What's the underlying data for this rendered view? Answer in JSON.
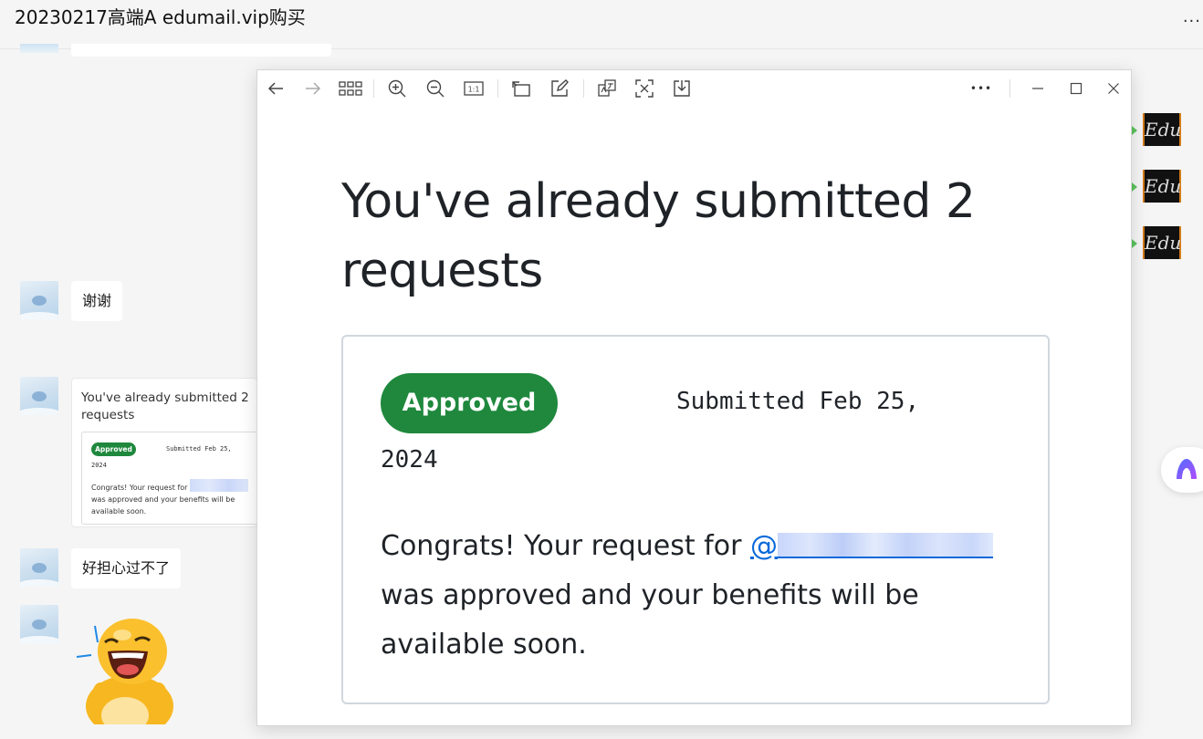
{
  "chat": {
    "title": "20230217高端A edumail.vip购买",
    "more": "...",
    "messages": [
      {
        "text": "谢谢"
      },
      {
        "text": "好担心过不了"
      }
    ],
    "thumbnail": {
      "title": "You've already submitted 2 requests",
      "badge": "Approved",
      "submitted": "Submitted Feb 25,",
      "year": "2024",
      "body_pre": "Congrats! Your request for",
      "body_post": "was approved and your benefits will be available soon."
    },
    "side_images": [
      {
        "label": "Edu"
      },
      {
        "label": "Edu"
      },
      {
        "label": "Edu"
      }
    ]
  },
  "viewer": {
    "toolbar": {
      "back_icon": "arrow-left-icon",
      "forward_icon": "arrow-right-icon",
      "gallery_icon": "grid-icon",
      "zoom_in_icon": "zoom-in-icon",
      "zoom_out_icon": "zoom-out-icon",
      "actual_size_label": "1:1",
      "rotate_icon": "rotate-icon",
      "edit_icon": "edit-icon",
      "translate_icon": "translate-icon",
      "extract_text_icon": "extract-text-icon",
      "download_icon": "download-icon",
      "more_label": "•••",
      "minimize_icon": "minimize-icon",
      "maximize_icon": "maximize-icon",
      "close_icon": "close-icon"
    },
    "image": {
      "title": "You've already submitted 2 requests",
      "badge": "Approved",
      "submitted": "Submitted Feb 25,",
      "year": "2024",
      "at_sign": "@",
      "body_pre": "Congrats! Your request for",
      "body_post": "was approved and your benefits will be available soon.",
      "badge_color": "#1f883d",
      "link_color": "#0969da"
    }
  }
}
